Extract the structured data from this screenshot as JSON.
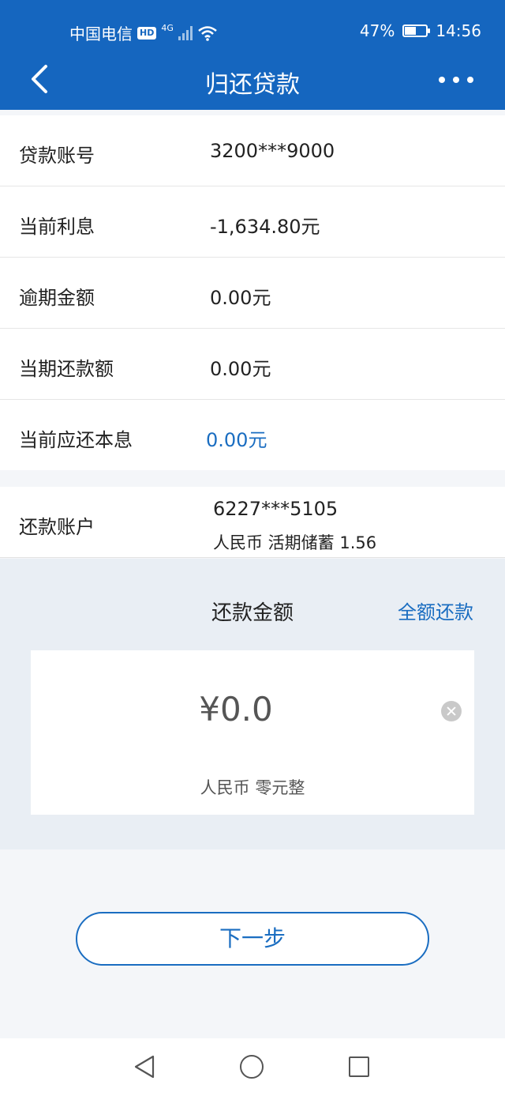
{
  "status_bar": {
    "carrier": "中国电信",
    "hd": "HD",
    "network": "4G",
    "battery_percent": "47%",
    "battery_level": 0.47,
    "time": "14:56"
  },
  "header": {
    "title": "归还贷款",
    "back_icon": "chevron-left-icon",
    "more_icon": "more-icon"
  },
  "loan_info": [
    {
      "label": "贷款账号",
      "value": "3200***9000"
    },
    {
      "label": "当前利息",
      "value": "-1,634.80元"
    },
    {
      "label": "逾期金额",
      "value": "0.00元"
    },
    {
      "label": "当期还款额",
      "value": "0.00元"
    },
    {
      "label": "当前应还本息",
      "value": "0.00元"
    }
  ],
  "repay_account": {
    "label": "还款账户",
    "number": "6227***5105",
    "detail": "人民币 活期储蓄 1.56"
  },
  "amount": {
    "title": "还款金额",
    "full_repay_label": "全额还款",
    "value": "¥0.0",
    "words": "人民币  零元整"
  },
  "next_button": "下一步",
  "colors": {
    "header_bg": "#1566bf",
    "accent": "#1a6dc1"
  }
}
